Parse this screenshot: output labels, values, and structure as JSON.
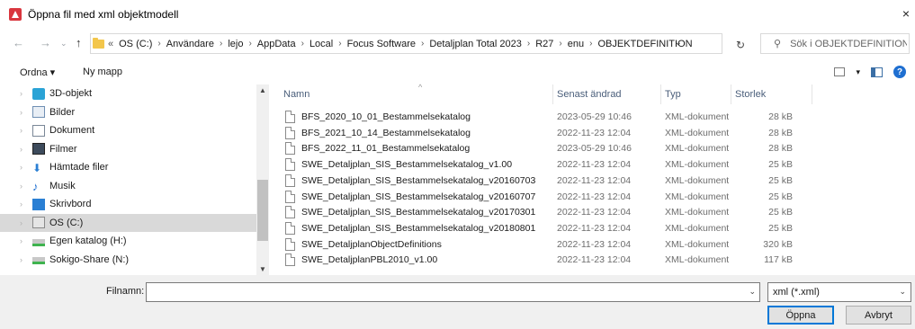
{
  "window": {
    "title": "Öppna fil med xml objektmodell",
    "close": "×"
  },
  "nav": {
    "back": "←",
    "forward": "→",
    "recent": "⌄",
    "up": "↑",
    "refresh": "↻"
  },
  "address": {
    "more": "«",
    "crumbs": [
      "OS (C:)",
      "Användare",
      "lejo",
      "AppData",
      "Local",
      "Focus Software",
      "Detaljplan Total 2023",
      "R27",
      "enu",
      "OBJEKTDEFINITION"
    ],
    "separator": "›",
    "dropdown": "⌄"
  },
  "search": {
    "placeholder": "Sök i OBJEKTDEFINITION"
  },
  "toolbar": {
    "organize": "Ordna ▾",
    "new_folder": "Ny mapp",
    "view_dropdown": "▾",
    "help": "?"
  },
  "tree": [
    {
      "label": "3D-objekt",
      "icon": "3d-objects-icon"
    },
    {
      "label": "Bilder",
      "icon": "pictures-icon"
    },
    {
      "label": "Dokument",
      "icon": "documents-icon"
    },
    {
      "label": "Filmer",
      "icon": "videos-icon"
    },
    {
      "label": "Hämtade filer",
      "icon": "downloads-icon"
    },
    {
      "label": "Musik",
      "icon": "music-icon"
    },
    {
      "label": "Skrivbord",
      "icon": "desktop-icon"
    },
    {
      "label": "OS (C:)",
      "icon": "drive-icon",
      "selected": true
    },
    {
      "label": "Egen katalog (H:)",
      "icon": "network-drive-icon"
    },
    {
      "label": "Sokigo-Share (N:)",
      "icon": "network-drive-icon"
    }
  ],
  "columns": {
    "name": "Namn",
    "date": "Senast ändrad",
    "type": "Typ",
    "size": "Storlek",
    "sort_indicator": "^"
  },
  "files": [
    {
      "name": "BFS_2020_10_01_Bestammelsekatalog",
      "date": "2023-05-29 10:46",
      "type": "XML-dokument",
      "size": "28 kB"
    },
    {
      "name": "BFS_2021_10_14_Bestammelsekatalog",
      "date": "2022-11-23 12:04",
      "type": "XML-dokument",
      "size": "28 kB"
    },
    {
      "name": "BFS_2022_11_01_Bestammelsekatalog",
      "date": "2023-05-29 10:46",
      "type": "XML-dokument",
      "size": "28 kB"
    },
    {
      "name": "SWE_Detaljplan_SIS_Bestammelsekatalog_v1.00",
      "date": "2022-11-23 12:04",
      "type": "XML-dokument",
      "size": "25 kB"
    },
    {
      "name": "SWE_Detaljplan_SIS_Bestammelsekatalog_v20160703",
      "date": "2022-11-23 12:04",
      "type": "XML-dokument",
      "size": "25 kB"
    },
    {
      "name": "SWE_Detaljplan_SIS_Bestammelsekatalog_v20160707",
      "date": "2022-11-23 12:04",
      "type": "XML-dokument",
      "size": "25 kB"
    },
    {
      "name": "SWE_Detaljplan_SIS_Bestammelsekatalog_v20170301",
      "date": "2022-11-23 12:04",
      "type": "XML-dokument",
      "size": "25 kB"
    },
    {
      "name": "SWE_Detaljplan_SIS_Bestammelsekatalog_v20180801",
      "date": "2022-11-23 12:04",
      "type": "XML-dokument",
      "size": "25 kB"
    },
    {
      "name": "SWE_DetaljplanObjectDefinitions",
      "date": "2022-11-23 12:04",
      "type": "XML-dokument",
      "size": "320 kB"
    },
    {
      "name": "SWE_DetaljplanPBL2010_v1.00",
      "date": "2022-11-23 12:04",
      "type": "XML-dokument",
      "size": "117 kB"
    }
  ],
  "footer": {
    "filename_label": "Filnamn:",
    "filename_value": "",
    "filter": "xml (*.xml)",
    "open": "Öppna",
    "cancel": "Avbryt"
  }
}
